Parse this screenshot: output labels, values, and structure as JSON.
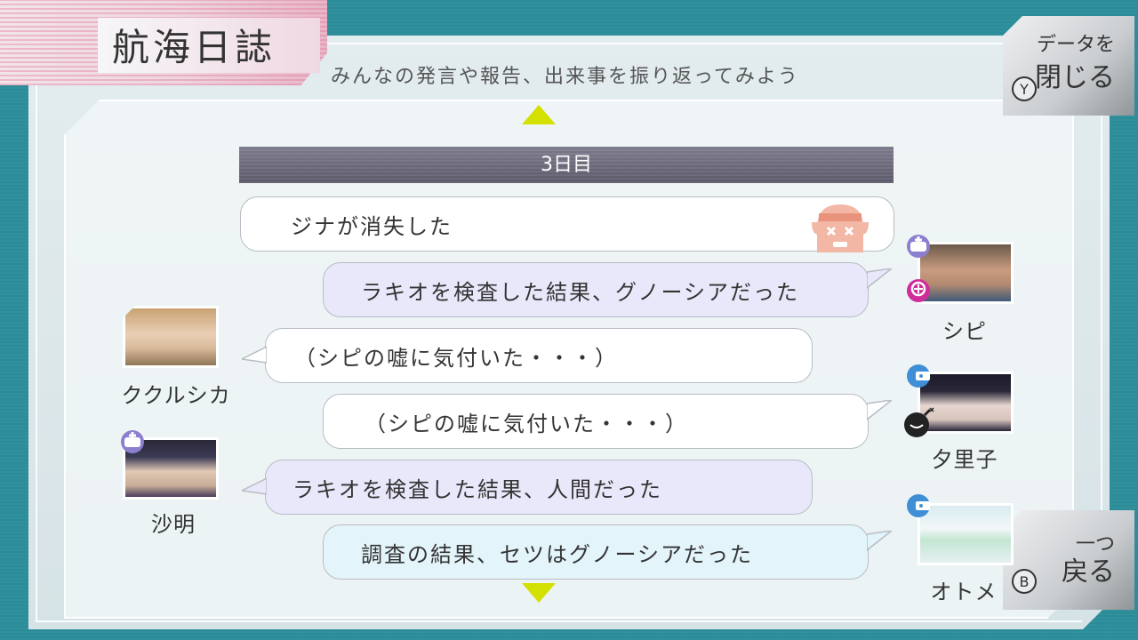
{
  "header": {
    "title": "航海日誌",
    "subtitle": "みんなの発言や報告、出来事を振り返ってみよう"
  },
  "buttons": {
    "close": {
      "line1": "データを",
      "line2": "閉じる",
      "key": "Y"
    },
    "back": {
      "line1": "一つ",
      "line2": "戻る",
      "key": "B"
    }
  },
  "log": {
    "day": "3日目",
    "entries": [
      {
        "text": "ジナが消失した",
        "style": "white",
        "speaker": ""
      },
      {
        "text": "ラキオを検査した結果、グノーシアだった",
        "style": "lav",
        "speaker": "シピ"
      },
      {
        "text": "（シピの嘘に気付いた・・・）",
        "style": "white",
        "speaker": "ククルシカ"
      },
      {
        "text": "（シピの嘘に気付いた・・・）",
        "style": "white",
        "speaker": "夕里子"
      },
      {
        "text": "ラキオを検査した結果、人間だった",
        "style": "lav",
        "speaker": "沙明"
      },
      {
        "text": "調査の結果、セツはグノーシアだった",
        "style": "blue",
        "speaker": "オトメ"
      }
    ]
  },
  "colors": {
    "accent_arrow": "#d4e000",
    "day_bar": "#5a5868",
    "bubble_lavender": "#e9e8fb",
    "bubble_blue": "#e3f4fb",
    "engineer_icon": "#3f8fd6",
    "doctor_icon": "#8d7fd0",
    "guardian_icon": "#d02c9a"
  },
  "icons": {
    "vanished": "vanished-face-icon",
    "doctor": "doctor-role-icon",
    "guardian": "guardian-role-icon",
    "engineer": "engineer-role-icon",
    "bomb": "bomb-icon"
  }
}
